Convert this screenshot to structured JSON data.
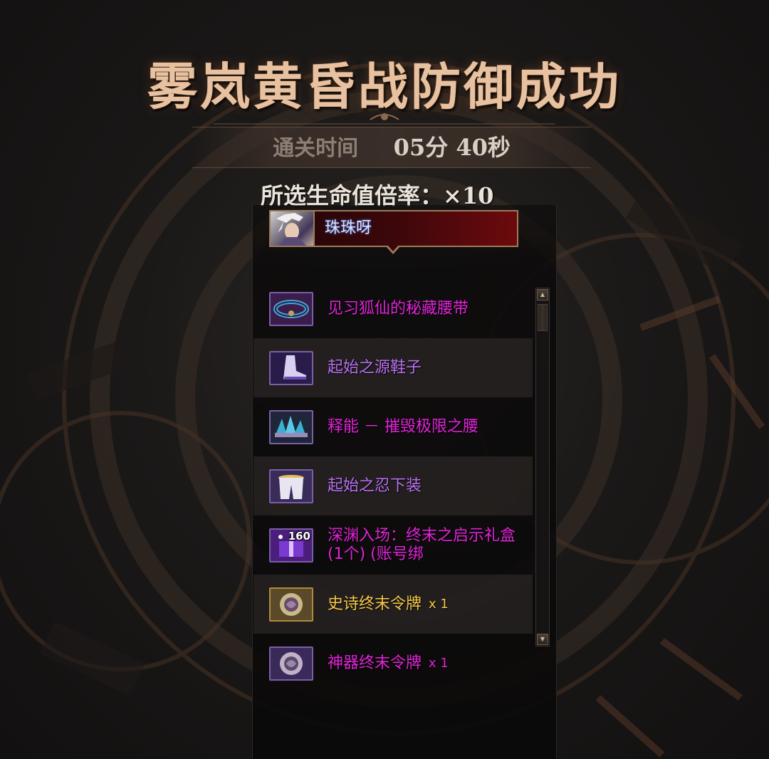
{
  "title": "雾岚黄昏战防御成功",
  "clear_time": {
    "label": "通关时间",
    "value": "05分 40秒"
  },
  "hp_rate": {
    "text": "所选生命值倍率：×10"
  },
  "player": {
    "name": "珠珠呀",
    "avatar_icon": "character-portrait-icon"
  },
  "rewards": [
    {
      "name": "见习狐仙的秘藏腰带",
      "icon": "belt-icon",
      "color": "#e024d8"
    },
    {
      "name": "起始之源鞋子",
      "icon": "shoes-icon",
      "color": "#b870f0"
    },
    {
      "name": "释能 － 摧毁极限之腰",
      "icon": "crystal-belt-icon",
      "color": "#e024d8"
    },
    {
      "name": "起始之忍下装",
      "icon": "pants-icon",
      "color": "#b870f0"
    },
    {
      "name": "深渊入场：终末之启示礼盒 (1个) (账号绑",
      "icon": "gift-box-icon",
      "badge": "160",
      "color": "#e024d8"
    },
    {
      "name": "史诗终末令牌",
      "qty": "x 1",
      "icon": "epic-token-icon",
      "color": "#f5c848"
    },
    {
      "name": "神器终末令牌",
      "qty": "x 1",
      "icon": "artifact-token-icon",
      "color": "#e024d8"
    }
  ],
  "scrollbar": {
    "up_icon": "arrow-up-icon",
    "down_icon": "arrow-down-icon"
  }
}
